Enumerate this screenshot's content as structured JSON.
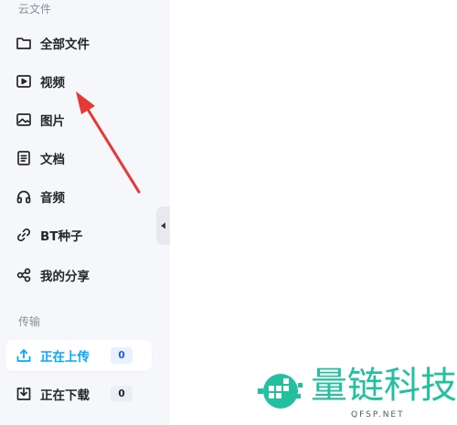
{
  "sidebar": {
    "sections": [
      {
        "title": "云文件"
      },
      {
        "title": "传输"
      }
    ],
    "cloud_items": [
      {
        "label": "全部文件",
        "icon": "folder-icon"
      },
      {
        "label": "视频",
        "icon": "video-play-icon"
      },
      {
        "label": "图片",
        "icon": "image-icon"
      },
      {
        "label": "文档",
        "icon": "document-icon"
      },
      {
        "label": "音频",
        "icon": "headphones-icon"
      },
      {
        "label": "BT种子",
        "icon": "link-icon"
      },
      {
        "label": "我的分享",
        "icon": "share-icon"
      }
    ],
    "transfer_items": [
      {
        "label": "正在上传",
        "count": "0",
        "icon": "upload-icon",
        "active": true
      },
      {
        "label": "正在下载",
        "count": "0",
        "icon": "download-icon",
        "active": false
      }
    ],
    "collapse_icon": "chevron-left-icon"
  },
  "colors": {
    "sidebar_bg": "#f6f7fa",
    "accent": "#06a7ff",
    "annotation_arrow": "#e53935",
    "watermark": "#23c0a0"
  },
  "watermark": {
    "title": "量链科技",
    "subtitle": "QFSP.NET"
  }
}
